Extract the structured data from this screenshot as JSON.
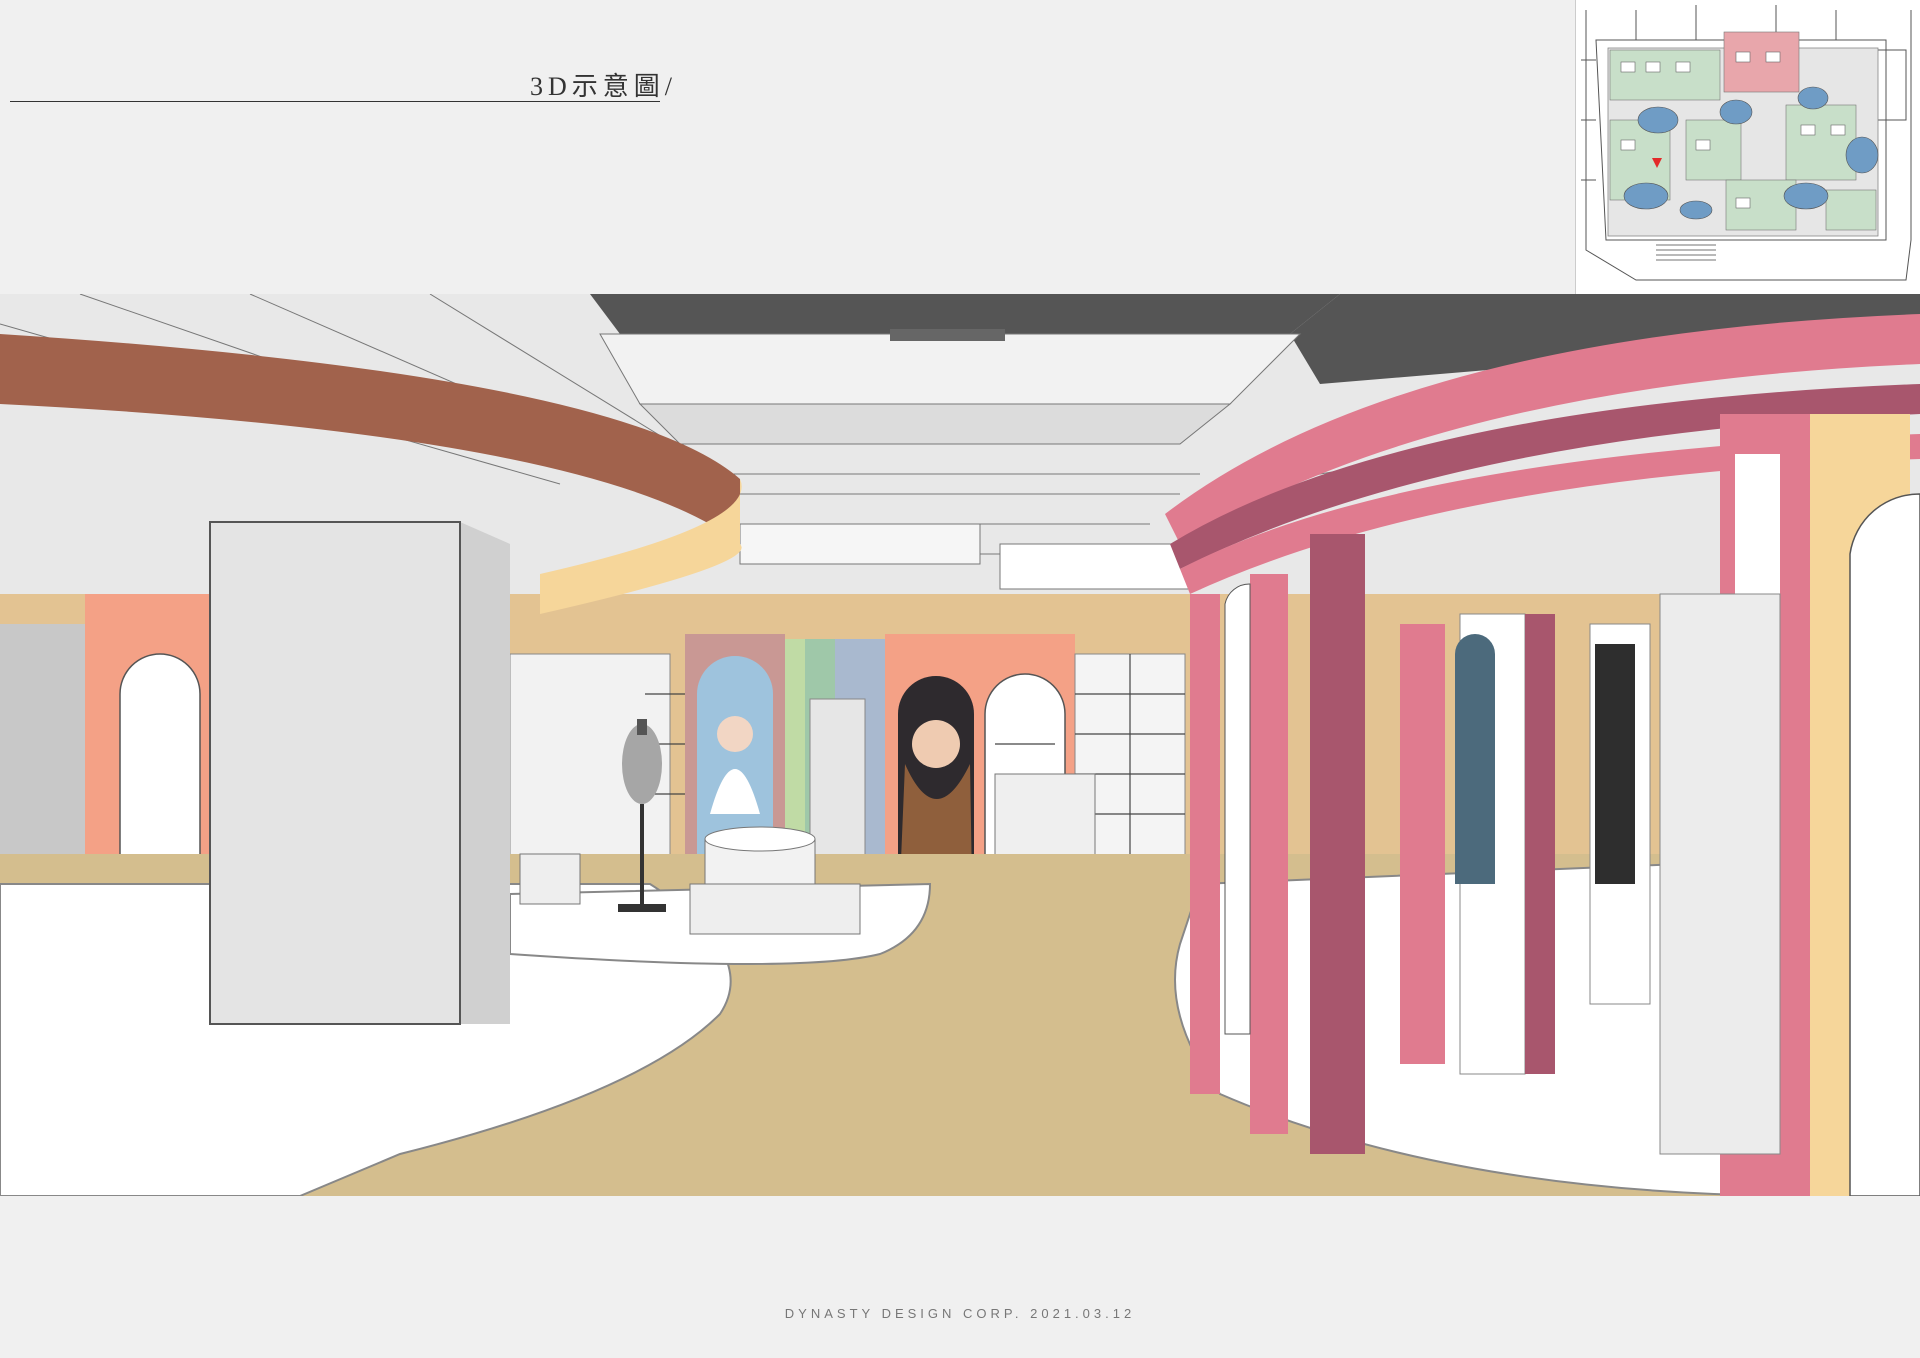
{
  "header": {
    "title": "3D示意圖/"
  },
  "rendering": {
    "colors": {
      "floor_path": "#d4be8e",
      "floor_zone": "#ffffff",
      "brown_ring": "#a1624c",
      "pink_frame": "#e07b8f",
      "pink_dark": "#a8566d",
      "peach_wall": "#f4a186",
      "tan_wall": "#e3c392",
      "column": "#e4e4e4",
      "ceiling_dark": "#555555",
      "mint_panel": "#9fc8a9",
      "blue_panel": "#a9b9cf",
      "cream_panel": "#f6d69a",
      "marble": "#ececec"
    }
  },
  "keyplan": {
    "colors": {
      "zone_green": "#c8dfc9",
      "zone_pink": "#e8a6ab",
      "island_blue": "#6f9cc5",
      "floor": "#e6e6e6",
      "marker": "#e32a2a"
    }
  },
  "footer": {
    "credit": "DYNASTY DESIGN CORP. 2021.03.12"
  }
}
